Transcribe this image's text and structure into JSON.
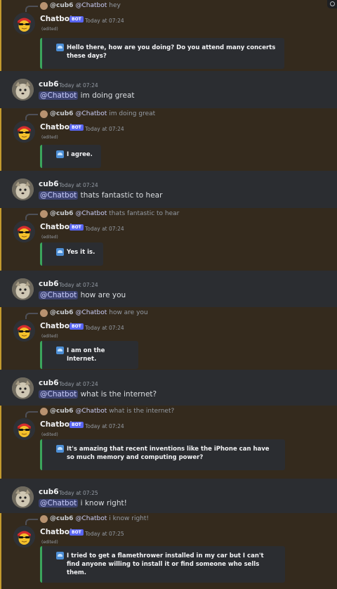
{
  "chatbot": {
    "name": "Chatbot",
    "badge": "BOT",
    "edited": "(edited)"
  },
  "user": {
    "name": "cub6",
    "mention": "@Chatbot"
  },
  "reply": {
    "prefix_user": "@cub6"
  },
  "colors": {
    "bot_bg": "#342a1d",
    "bot_border": "#c39a2e",
    "embed_border": "#3ba55c",
    "mention_bg": "#3c4270",
    "badge_bg": "#5865f2"
  },
  "messages": [
    {
      "author": "Chatbot",
      "kind": "bot",
      "reply_text": "hey",
      "time": "Today at 07:24",
      "embed": "Hello there, how are you doing? Do you attend many concerts these days?"
    },
    {
      "author": "cub6",
      "kind": "user",
      "time": "Today at 07:24",
      "content": "im doing great"
    },
    {
      "author": "Chatbot",
      "kind": "bot",
      "reply_text": "im doing great",
      "time": "Today at 07:24",
      "embed": "I agree."
    },
    {
      "author": "cub6",
      "kind": "user",
      "time": "Today at 07:24",
      "content": "thats fantastic to hear"
    },
    {
      "author": "Chatbot",
      "kind": "bot",
      "reply_text": "thats fantastic to hear",
      "time": "Today at 07:24",
      "embed": "Yes it is."
    },
    {
      "author": "cub6",
      "kind": "user",
      "time": "Today at 07:24",
      "content": "how are you"
    },
    {
      "author": "Chatbot",
      "kind": "bot",
      "reply_text": "how are you",
      "time": "Today at 07:24",
      "embed": "I am on the Internet."
    },
    {
      "author": "cub6",
      "kind": "user",
      "time": "Today at 07:24",
      "content": "what is the internet?"
    },
    {
      "author": "Chatbot",
      "kind": "bot",
      "reply_text": "what is the internet?",
      "time": "Today at 07:24",
      "embed": "It's amazing that recent inventions like the iPhone can have so much memory and computing power?"
    },
    {
      "author": "cub6",
      "kind": "user",
      "time": "Today at 07:25",
      "content": "i know right!"
    },
    {
      "author": "Chatbot",
      "kind": "bot",
      "reply_text": "i know right!",
      "time": "Today at 07:25",
      "embed": "I tried to get a flamethrower installed in my car but I can't find anyone willing to install it or find someone who sells them."
    }
  ]
}
